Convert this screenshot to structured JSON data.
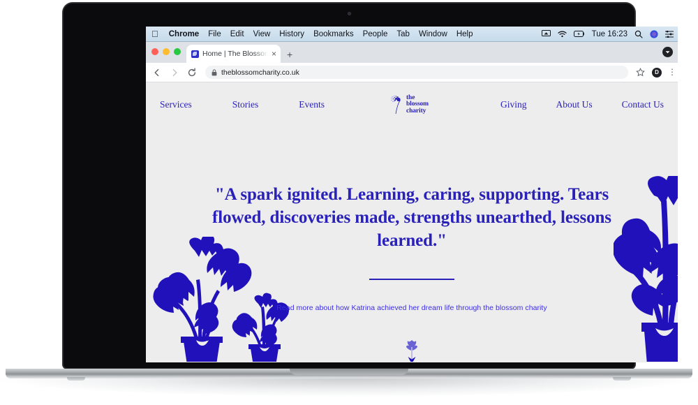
{
  "device": {
    "label": "MacBook Pro",
    "camera_icon": "camera-icon"
  },
  "menubar": {
    "apple_icon": "apple-logo-icon",
    "items": [
      {
        "label": "Chrome",
        "bold": true
      },
      {
        "label": "File",
        "bold": false
      },
      {
        "label": "Edit",
        "bold": false
      },
      {
        "label": "View",
        "bold": false
      },
      {
        "label": "History",
        "bold": false
      },
      {
        "label": "Bookmarks",
        "bold": false
      },
      {
        "label": "People",
        "bold": false
      },
      {
        "label": "Tab",
        "bold": false
      },
      {
        "label": "Window",
        "bold": false
      },
      {
        "label": "Help",
        "bold": false
      }
    ],
    "status": {
      "screen_mirroring_icon": "screen-mirroring-icon",
      "wifi_icon": "wifi-icon",
      "battery_icon": "battery-charging-icon",
      "clock": "Tue 16:23",
      "search_icon": "spotlight-search-icon",
      "siri_icon": "siri-icon",
      "control_center_icon": "control-center-icon"
    }
  },
  "browser": {
    "traffic_lights": {
      "close": "#ff5f57",
      "minimize": "#febc2e",
      "zoom": "#28c840"
    },
    "tab": {
      "title": "Home | The Blossom Charity | ",
      "favicon": "site-favicon",
      "close_label": "×"
    },
    "new_tab_label": "+",
    "tabstrip_end_icon": "profile-badge-icon",
    "toolbar": {
      "back_icon": "back-arrow-icon",
      "forward_icon": "forward-arrow-icon",
      "reload_icon": "reload-icon",
      "lock_icon": "padlock-icon",
      "url": "theblossomcharity.co.uk",
      "bookmark_icon": "star-icon",
      "avatar_initial": "D",
      "menu_icon": "three-dot-menu-icon"
    }
  },
  "site": {
    "brand_color": "#2a22b8",
    "link_color": "#3b2ee0",
    "background_color": "#eeeded",
    "nav_left": [
      {
        "label": "Services"
      },
      {
        "label": "Stories"
      },
      {
        "label": "Events"
      }
    ],
    "nav_right": [
      {
        "label": "Giving"
      },
      {
        "label": "About Us"
      },
      {
        "label": "Contact Us"
      }
    ],
    "logo": {
      "line1": "the",
      "line2": "blossom",
      "line3": "charity",
      "mark_icon": "blossom-dandelion-icon"
    },
    "hero": {
      "quote": "\"A spark ignited. Learning, caring, supporting. Tears flowed, discoveries made, strengths unearthed, lessons learned.\"",
      "subtext": "Read more about how Katrina achieved her dream life through the blossom charity",
      "scroll_icon": "down-arrow-icon"
    },
    "decor": {
      "left_plant_icon": "monstera-plants-icon",
      "right_plant_icon": "monstera-plant-icon"
    }
  }
}
